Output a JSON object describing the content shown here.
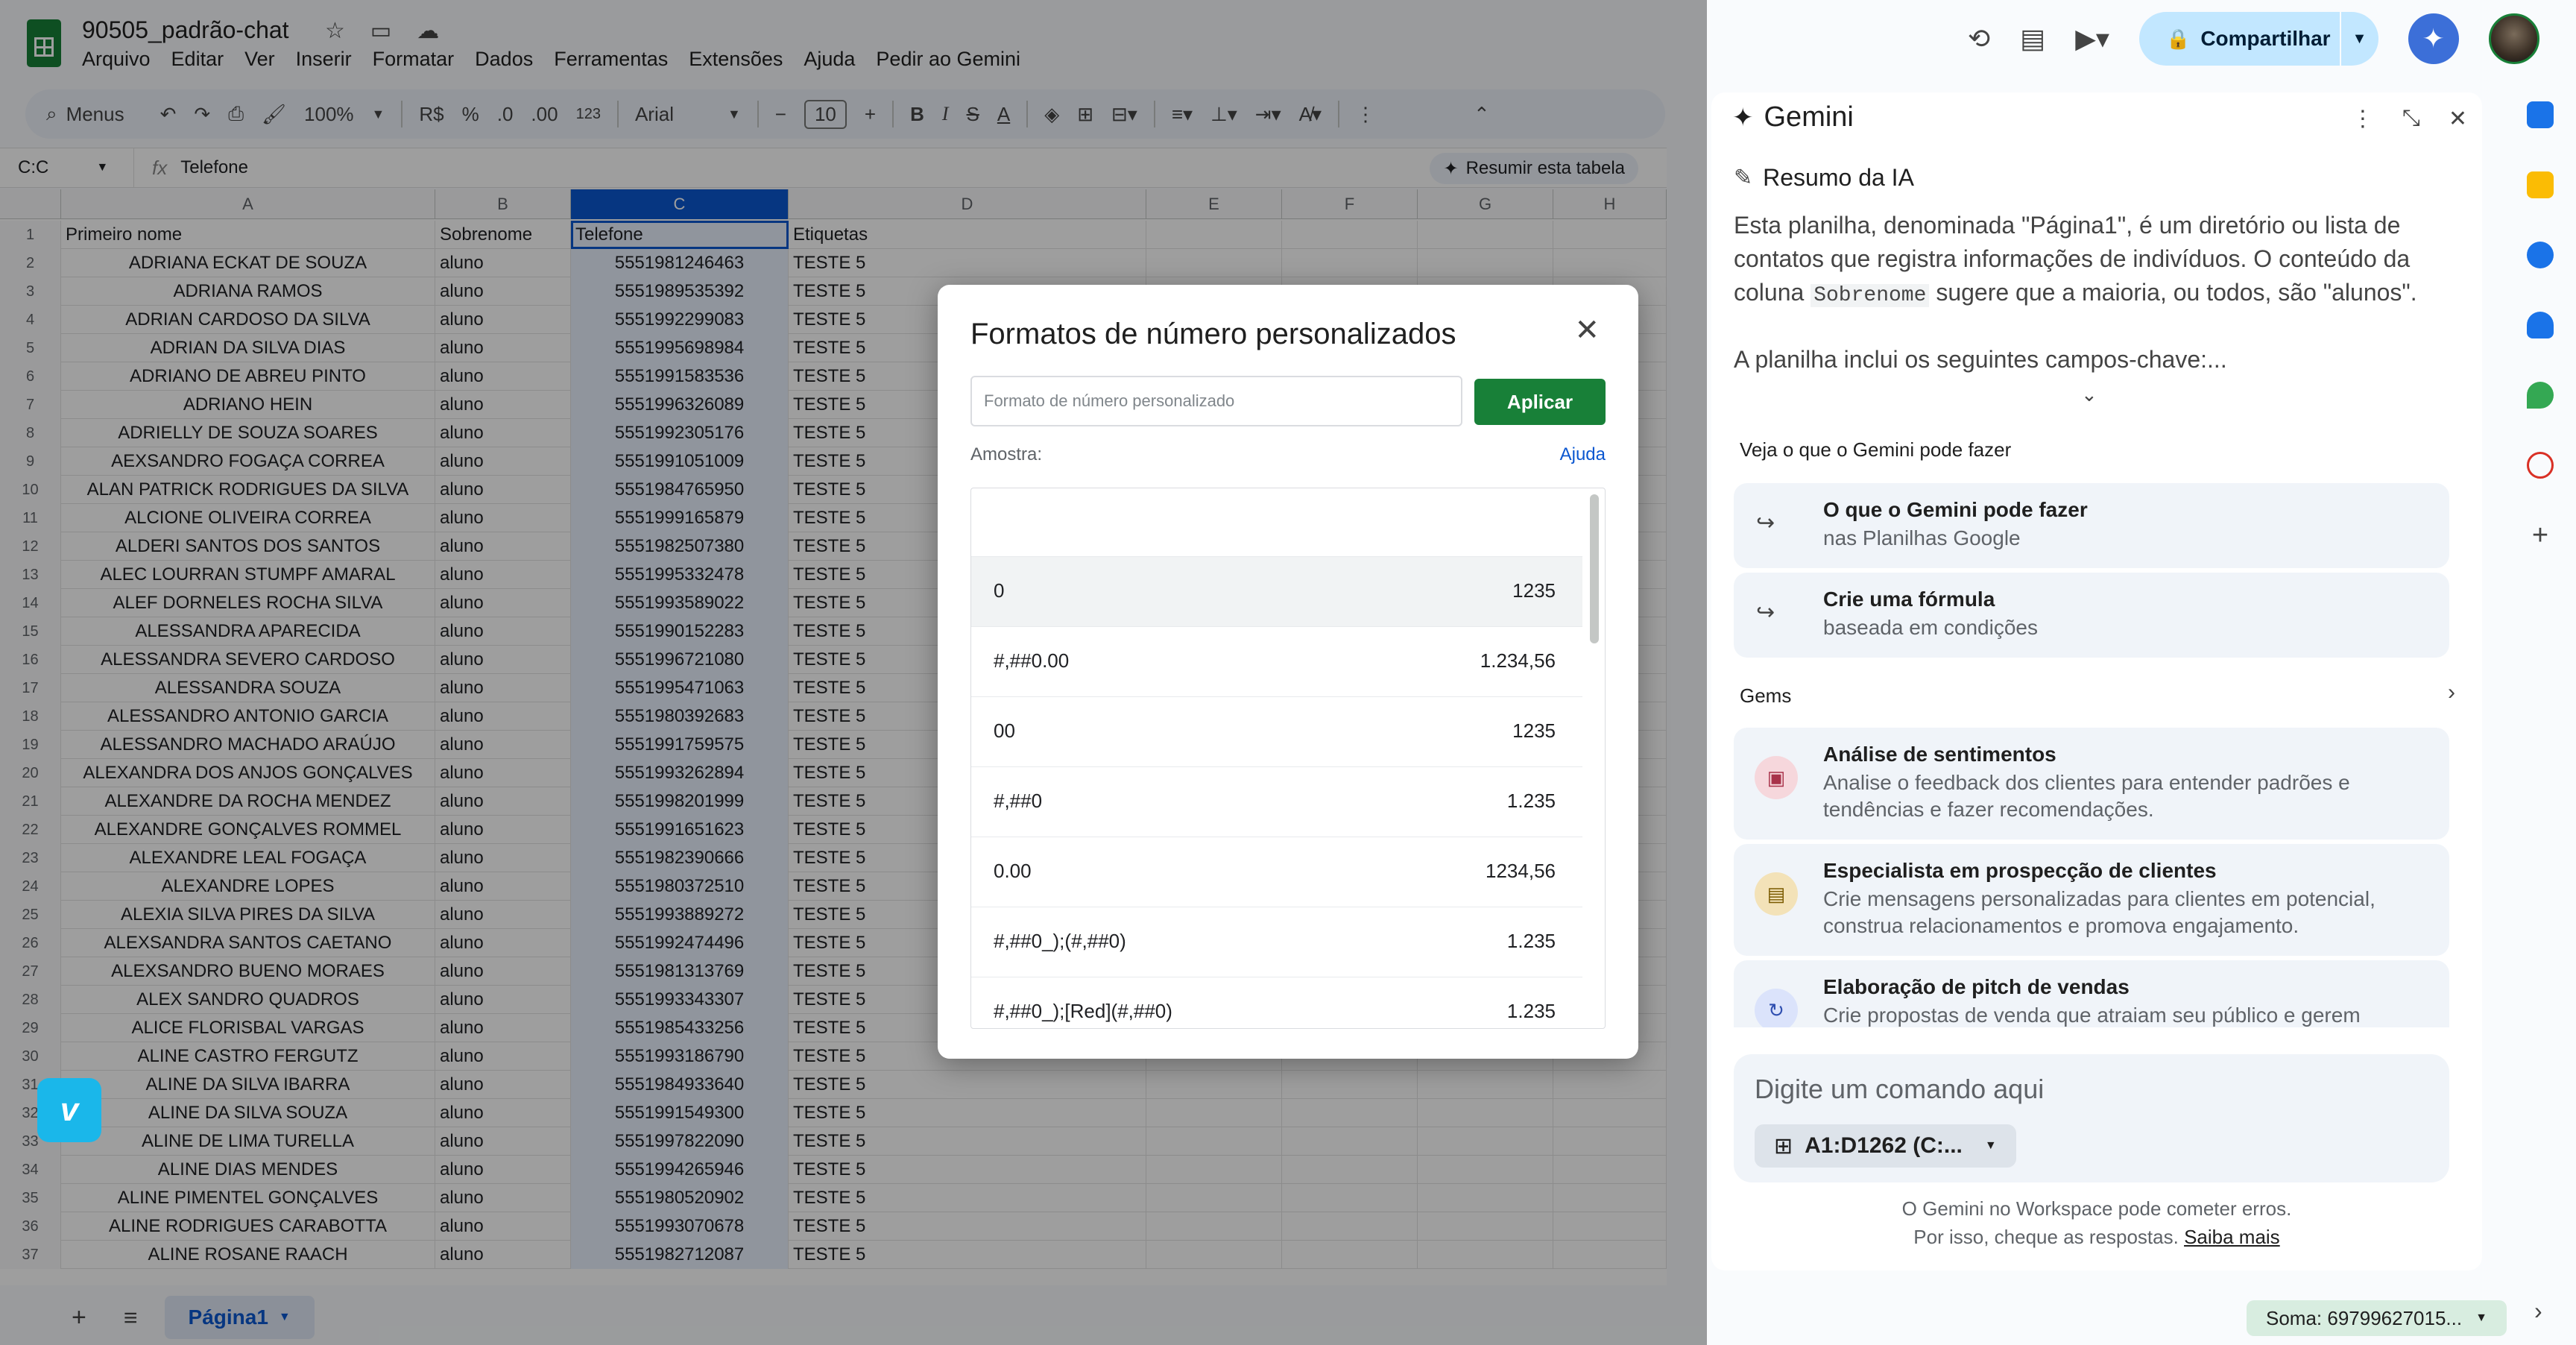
{
  "app": {
    "doc_title": "90505_padrão-chat",
    "menus": [
      "Arquivo",
      "Editar",
      "Ver",
      "Inserir",
      "Formatar",
      "Dados",
      "Ferramentas",
      "Extensões",
      "Ajuda",
      "Pedir ao Gemini"
    ],
    "share_label": "Compartilhar"
  },
  "toolbar": {
    "search": "Menus",
    "zoom": "100%",
    "currency": "R$",
    "percent": "%",
    "dec_less": ".0",
    "dec_more": ".00",
    "num_format": "123",
    "font": "Arial",
    "font_size": "10"
  },
  "formula": {
    "cell_ref": "C:C",
    "fx": "fx",
    "content": "Telefone",
    "summarize": "Resumir esta tabela"
  },
  "grid": {
    "columns": [
      "A",
      "B",
      "C",
      "D",
      "E",
      "F",
      "G",
      "H"
    ],
    "rows": [
      [
        "1",
        "Primeiro nome",
        "Sobrenome",
        "Telefone",
        "Etiquetas"
      ],
      [
        "2",
        "ADRIANA ECKAT DE SOUZA",
        "aluno",
        "5551981246463",
        "TESTE 5"
      ],
      [
        "3",
        "ADRIANA RAMOS",
        "aluno",
        "5551989535392",
        "TESTE 5"
      ],
      [
        "4",
        "ADRIAN CARDOSO DA SILVA",
        "aluno",
        "5551992299083",
        "TESTE 5"
      ],
      [
        "5",
        "ADRIAN DA SILVA DIAS",
        "aluno",
        "5551995698984",
        "TESTE 5"
      ],
      [
        "6",
        "ADRIANO DE ABREU PINTO",
        "aluno",
        "5551991583536",
        "TESTE 5"
      ],
      [
        "7",
        "ADRIANO HEIN",
        "aluno",
        "5551996326089",
        "TESTE 5"
      ],
      [
        "8",
        "ADRIELLY DE SOUZA SOARES",
        "aluno",
        "5551992305176",
        "TESTE 5"
      ],
      [
        "9",
        "AEXSANDRO FOGAÇA CORREA",
        "aluno",
        "5551991051009",
        "TESTE 5"
      ],
      [
        "10",
        "ALAN PATRICK RODRIGUES DA SILVA",
        "aluno",
        "5551984765950",
        "TESTE 5"
      ],
      [
        "11",
        "ALCIONE OLIVEIRA CORREA",
        "aluno",
        "5551999165879",
        "TESTE 5"
      ],
      [
        "12",
        "ALDERI SANTOS DOS SANTOS",
        "aluno",
        "5551982507380",
        "TESTE 5"
      ],
      [
        "13",
        "ALEC LOURRAN STUMPF AMARAL",
        "aluno",
        "5551995332478",
        "TESTE 5"
      ],
      [
        "14",
        "ALEF DORNELES ROCHA SILVA",
        "aluno",
        "5551993589022",
        "TESTE 5"
      ],
      [
        "15",
        "ALESSANDRA APARECIDA",
        "aluno",
        "5551990152283",
        "TESTE 5"
      ],
      [
        "16",
        "ALESSANDRA SEVERO CARDOSO",
        "aluno",
        "5551996721080",
        "TESTE 5"
      ],
      [
        "17",
        "ALESSANDRA SOUZA",
        "aluno",
        "5551995471063",
        "TESTE 5"
      ],
      [
        "18",
        "ALESSANDRO ANTONIO GARCIA",
        "aluno",
        "5551980392683",
        "TESTE 5"
      ],
      [
        "19",
        "ALESSANDRO MACHADO ARAÚJO",
        "aluno",
        "5551991759575",
        "TESTE 5"
      ],
      [
        "20",
        "ALEXANDRA DOS ANJOS GONÇALVES",
        "aluno",
        "5551993262894",
        "TESTE 5"
      ],
      [
        "21",
        "ALEXANDRE DA ROCHA MENDEZ",
        "aluno",
        "5551998201999",
        "TESTE 5"
      ],
      [
        "22",
        "ALEXANDRE GONÇALVES ROMMEL",
        "aluno",
        "5551991651623",
        "TESTE 5"
      ],
      [
        "23",
        "ALEXANDRE LEAL FOGAÇA",
        "aluno",
        "5551982390666",
        "TESTE 5"
      ],
      [
        "24",
        "ALEXANDRE LOPES",
        "aluno",
        "5551980372510",
        "TESTE 5"
      ],
      [
        "25",
        "ALEXIA SILVA PIRES DA SILVA",
        "aluno",
        "5551993889272",
        "TESTE 5"
      ],
      [
        "26",
        "ALEXSANDRA SANTOS CAETANO",
        "aluno",
        "5551992474496",
        "TESTE 5"
      ],
      [
        "27",
        "ALEXSANDRO BUENO MORAES",
        "aluno",
        "5551981313769",
        "TESTE 5"
      ],
      [
        "28",
        "ALEX SANDRO QUADROS",
        "aluno",
        "5551993343307",
        "TESTE 5"
      ],
      [
        "29",
        "ALICE FLORISBAL VARGAS",
        "aluno",
        "5551985433256",
        "TESTE 5"
      ],
      [
        "30",
        "ALINE CASTRO FERGUTZ",
        "aluno",
        "5551993186790",
        "TESTE 5"
      ],
      [
        "31",
        "ALINE DA SILVA IBARRA",
        "aluno",
        "5551984933640",
        "TESTE 5"
      ],
      [
        "32",
        "ALINE DA SILVA SOUZA",
        "aluno",
        "5551991549300",
        "TESTE 5"
      ],
      [
        "33",
        "ALINE DE LIMA TURELLA",
        "aluno",
        "5551997822090",
        "TESTE 5"
      ],
      [
        "34",
        "ALINE DIAS MENDES",
        "aluno",
        "5551994265946",
        "TESTE 5"
      ],
      [
        "35",
        "ALINE PIMENTEL GONÇALVES",
        "aluno",
        "5551980520902",
        "TESTE 5"
      ],
      [
        "36",
        "ALINE RODRIGUES CARABOTTA",
        "aluno",
        "5551993070678",
        "TESTE 5"
      ],
      [
        "37",
        "ALINE ROSANE RAACH",
        "aluno",
        "5551982712087",
        "TESTE 5"
      ]
    ]
  },
  "dialog": {
    "title": "Formatos de número personalizados",
    "input_placeholder": "Formato de número personalizado",
    "apply_label": "Aplicar",
    "sample_label": "Amostra:",
    "help_label": "Ajuda",
    "formats": [
      {
        "code": "",
        "value": ""
      },
      {
        "code": "0",
        "value": "1235"
      },
      {
        "code": "#,##0.00",
        "value": "1.234,56"
      },
      {
        "code": "00",
        "value": "1235"
      },
      {
        "code": "#,##0",
        "value": "1.235"
      },
      {
        "code": "0.00",
        "value": "1234,56"
      },
      {
        "code": "#,##0_);(#,##0)",
        "value": "1.235"
      },
      {
        "code": "#,##0_);[Red](#,##0)",
        "value": "1.235"
      }
    ]
  },
  "gemini": {
    "title": "Gemini",
    "summary_title": "Resumo da IA",
    "summary_part1": "Esta planilha, denominada \"Página1\", é um diretório ou lista de contatos que registra informações de indivíduos. O conteúdo da coluna ",
    "summary_code": "Sobrenome",
    "summary_part2": " sugere que a maioria, ou todos, são \"alunos\".",
    "summary_part3": "A planilha inclui os seguintes campos-chave:...",
    "section_what": "Veja o que o Gemini pode fazer",
    "cards": [
      {
        "title": "O que o Gemini pode fazer",
        "sub": "nas Planilhas Google"
      },
      {
        "title": "Crie uma fórmula",
        "sub": "baseada em condições"
      }
    ],
    "section_gems": "Gems",
    "gems": [
      {
        "title": "Análise de sentimentos",
        "sub": "Analise o feedback dos clientes para entender padrões e tendências e fazer recomendações."
      },
      {
        "title": "Especialista em prospecção de clientes",
        "sub": "Crie mensagens personalizadas para clientes em potencial, construa relacionamentos e promova engajamento."
      },
      {
        "title": "Elaboração de pitch de vendas",
        "sub": "Crie propostas de venda que atraiam seu público e gerem"
      }
    ],
    "prompt_placeholder": "Digite um comando aqui",
    "range_chip": "A1:D1262 (C:...",
    "disclaimer_line1": "O Gemini no Workspace pode cometer erros.",
    "disclaimer_line2": "Por isso, cheque as respostas.",
    "disclaimer_link": "Saiba mais"
  },
  "footer": {
    "sheet_tab": "Página1",
    "sum": "Soma: 69799627015..."
  },
  "icons": {
    "vimeo": "v"
  }
}
